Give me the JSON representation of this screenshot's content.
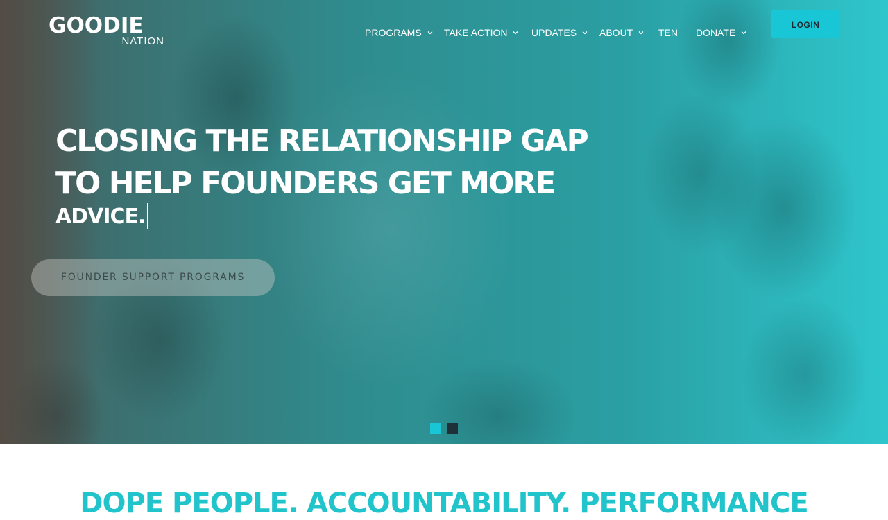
{
  "brand": {
    "name": "GOODIE",
    "sub": "NATION"
  },
  "nav": {
    "items": [
      {
        "label": "PROGRAMS",
        "dropdown": true
      },
      {
        "label": "TAKE ACTION",
        "dropdown": true
      },
      {
        "label": "UPDATES",
        "dropdown": true
      },
      {
        "label": "ABOUT",
        "dropdown": true
      },
      {
        "label": "TEN",
        "dropdown": false
      },
      {
        "label": "DONATE",
        "dropdown": true
      }
    ],
    "login_label": "LOGIN"
  },
  "hero": {
    "headline_lines": [
      "CLOSING THE RELATIONSHIP GAP",
      "TO HELP FOUNDERS GET MORE",
      "ADVICE."
    ],
    "cta_label": "FOUNDER SUPPORT PROGRAMS",
    "slides_total": 2,
    "active_slide": 1
  },
  "section": {
    "title": "DOPE PEOPLE. ACCOUNTABILITY. PERFORMANCE"
  },
  "colors": {
    "accent": "#19c6d6",
    "dark": "#1e3138",
    "heading": "#22c4cc"
  },
  "icons": [
    "chevron-down-icon"
  ]
}
